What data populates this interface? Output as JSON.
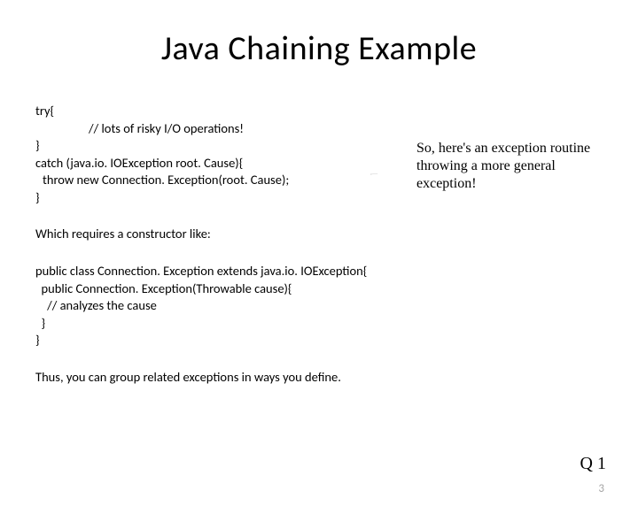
{
  "title": "Java Chaining Example",
  "code1": {
    "l1": "try{",
    "l2": "// lots of risky I/O operations!",
    "l3": "}",
    "l4": "catch (java.io. IOException root. Cause){",
    "l5": "throw new Connection. Exception(root. Cause);",
    "l6": "}"
  },
  "annotation": "So, here's an exception routine throwing a more general exception!",
  "para1": "Which requires a constructor like:",
  "code2": {
    "l1": "public class Connection. Exception extends java.io. IOException{",
    "l2": "  public Connection. Exception(Throwable cause){",
    "l3": "    // analyzes the cause",
    "l4": "  }",
    "l5": "}"
  },
  "para2": "Thus, you can group related exceptions in ways you define.",
  "q_label": "Q 1",
  "page_number": "3"
}
